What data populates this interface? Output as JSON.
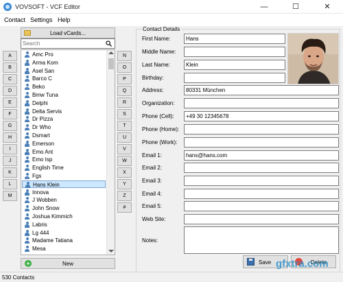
{
  "window": {
    "title": "VOVSOFT - VCF Editor",
    "min_glyph": "—",
    "max_glyph": "☐",
    "close_glyph": "✕"
  },
  "menu": {
    "items": [
      "Contact",
      "Settings",
      "Help"
    ]
  },
  "alphabet": {
    "left": [
      "A",
      "B",
      "C",
      "D",
      "E",
      "F",
      "G",
      "H",
      "I",
      "J",
      "K",
      "L",
      "M"
    ],
    "right": [
      "N",
      "O",
      "P",
      "Q",
      "R",
      "S",
      "T",
      "U",
      "V",
      "W",
      "X",
      "Y",
      "Z",
      "#"
    ]
  },
  "list_panel": {
    "load_label": "Load vCards...",
    "search_placeholder": "Search",
    "new_label": "New",
    "selected_index": 16,
    "contacts": [
      "Amc Pro",
      "Arma Kom",
      "Asel San",
      "Barco C",
      "Beko",
      "Bmw Tuna",
      "Delphi",
      "Delta Servis",
      "Dr Pizza",
      "Dr Who",
      "Dsmart",
      "Emerson",
      "Emo Ant",
      "Emo Isp",
      "English Time",
      "Fgs",
      "Hans Klein",
      "Innova",
      "J Wobben",
      "John Snow",
      "Joshua Kimmich",
      "Labris",
      "Lg 444",
      "Madame Tatiana",
      "Mesa"
    ]
  },
  "details": {
    "group_title": "Contact Details",
    "fields": [
      {
        "label": "First Name:",
        "value": "Hans"
      },
      {
        "label": "Middle Name:",
        "value": ""
      },
      {
        "label": "Last Name:",
        "value": "Klein"
      },
      {
        "label": "Birthday:",
        "value": ""
      },
      {
        "label": "Address:",
        "value": "80331 München"
      },
      {
        "label": "Organization:",
        "value": ""
      },
      {
        "label": "Phone (Cell):",
        "value": "+49 30 12345678"
      },
      {
        "label": "Phone (Home):",
        "value": ""
      },
      {
        "label": "Phone (Work):",
        "value": ""
      },
      {
        "label": "Email 1:",
        "value": "hans@hans.com"
      },
      {
        "label": "Email 2:",
        "value": ""
      },
      {
        "label": "Email 3:",
        "value": ""
      },
      {
        "label": "Email 4:",
        "value": ""
      },
      {
        "label": "Email 5:",
        "value": ""
      },
      {
        "label": "Web Site:",
        "value": ""
      }
    ],
    "notes_label": "Notes:",
    "notes_value": "",
    "save_label": "Save",
    "delete_label": "Delete"
  },
  "status": {
    "text": "530 Contacts"
  },
  "watermark": "gfxtra.com",
  "colors": {
    "selection": "#cce8ff",
    "accent": "#3a8ad8"
  }
}
